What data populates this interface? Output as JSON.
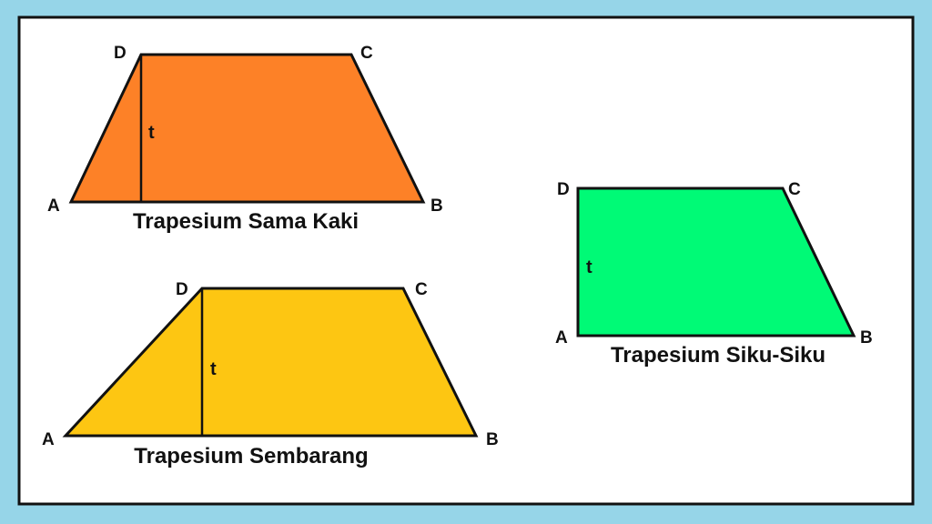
{
  "colors": {
    "outer_border": "#96d5e8",
    "canvas": "#ffffff",
    "frame": "#111111",
    "shape_outline": "#111111",
    "isosceles_fill": "#fd8127",
    "scalene_fill": "#fdc612",
    "right_fill": "#00fa76"
  },
  "diagram": {
    "isosceles": {
      "title": "Trapesium Sama Kaki",
      "vertices": {
        "a": "A",
        "b": "B",
        "c": "C",
        "d": "D"
      },
      "height_label": "t"
    },
    "scalene": {
      "title": "Trapesium Sembarang",
      "vertices": {
        "a": "A",
        "b": "B",
        "c": "C",
        "d": "D"
      },
      "height_label": "t"
    },
    "right": {
      "title": "Trapesium Siku-Siku",
      "vertices": {
        "a": "A",
        "b": "B",
        "c": "C",
        "d": "D"
      },
      "height_label": "t"
    }
  }
}
